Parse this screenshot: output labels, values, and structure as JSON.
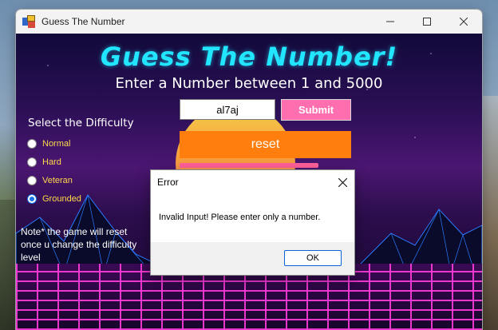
{
  "window": {
    "title": "Guess The Number",
    "controls": [
      "minimize-icon",
      "maximize-icon",
      "close-icon"
    ]
  },
  "game": {
    "heading": "Guess The Number!",
    "subheading": "Enter a Number between 1 and 5000",
    "difficulty_label": "Select the Difficulty",
    "difficulties": [
      {
        "label": "Normal",
        "checked": false
      },
      {
        "label": "Hard",
        "checked": false
      },
      {
        "label": "Veteran",
        "checked": false
      },
      {
        "label": "Grounded",
        "checked": true
      }
    ],
    "input_value": "al7aj",
    "submit_label": "Submit",
    "reset_label": "reset",
    "note": "Note* the game will reset once u change the difficulty level"
  },
  "dialog": {
    "title": "Error",
    "message": "Invalid Input! Please enter only a number.",
    "ok_label": "OK"
  },
  "colors": {
    "heading": "#22e6ff",
    "submit": "#ff6fb0",
    "reset": "#ff7e0d",
    "radio_text": "#ffd84a",
    "ok_border": "#0a64d6"
  }
}
